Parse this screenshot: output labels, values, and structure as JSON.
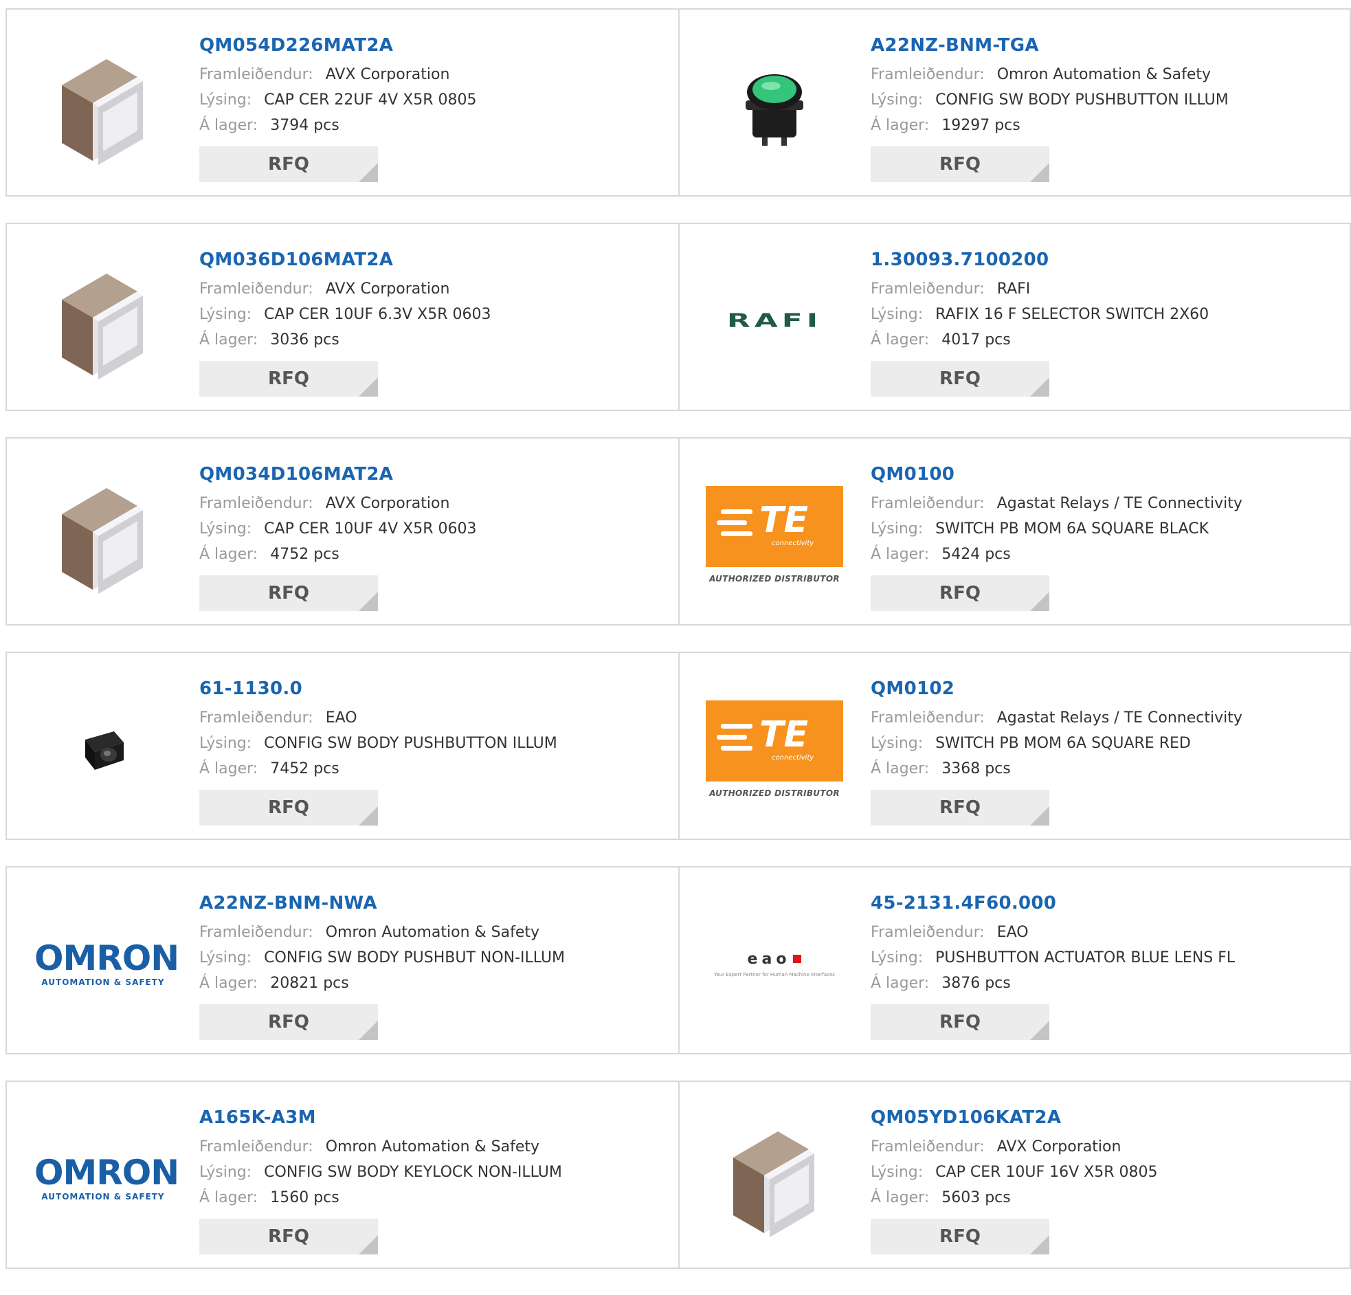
{
  "labels": {
    "manufacturer": "Framleiðendur:",
    "description": "Lýsing:",
    "stock": "Á lager:",
    "rfq": "RFQ"
  },
  "products": [
    {
      "part": "QM054D226MAT2A",
      "manufacturer": "AVX Corporation",
      "description": "CAP CER 22UF 4V X5R 0805",
      "stock": "3794 pcs",
      "image": "capacitor-chip"
    },
    {
      "part": "A22NZ-BNM-TGA",
      "manufacturer": "Omron Automation & Safety",
      "description": "CONFIG SW BODY PUSHBUTTON ILLUM",
      "stock": "19297 pcs",
      "image": "green-pushbutton"
    },
    {
      "part": "QM036D106MAT2A",
      "manufacturer": "AVX Corporation",
      "description": "CAP CER 10UF 6.3V X5R 0603",
      "stock": "3036 pcs",
      "image": "capacitor-chip"
    },
    {
      "part": "1.30093.7100200",
      "manufacturer": "RAFI",
      "description": "RAFIX 16 F SELECTOR SWITCH 2X60",
      "stock": "4017 pcs",
      "image": "rafi-logo",
      "logo_text": "RAFI"
    },
    {
      "part": "QM034D106MAT2A",
      "manufacturer": "AVX Corporation",
      "description": "CAP CER 10UF 4V X5R 0603",
      "stock": "4752 pcs",
      "image": "capacitor-chip"
    },
    {
      "part": "QM0100",
      "manufacturer": "Agastat Relays / TE Connectivity",
      "description": "SWITCH PB MOM 6A SQUARE BLACK",
      "stock": "5424 pcs",
      "image": "te-logo",
      "logo_text": "TE",
      "logo_sub": "connectivity",
      "logo_caption": "AUTHORIZED DISTRIBUTOR"
    },
    {
      "part": "61-1130.0",
      "manufacturer": "EAO",
      "description": "CONFIG SW BODY PUSHBUTTON ILLUM",
      "stock": "7452 pcs",
      "image": "black-pushbutton"
    },
    {
      "part": "QM0102",
      "manufacturer": "Agastat Relays / TE Connectivity",
      "description": "SWITCH PB MOM 6A SQUARE RED",
      "stock": "3368 pcs",
      "image": "te-logo",
      "logo_text": "TE",
      "logo_sub": "connectivity",
      "logo_caption": "AUTHORIZED DISTRIBUTOR"
    },
    {
      "part": "A22NZ-BNM-NWA",
      "manufacturer": "Omron Automation & Safety",
      "description": "CONFIG SW BODY PUSHBUT NON-ILLUM",
      "stock": "20821 pcs",
      "image": "omron-logo",
      "logo_text": "OMRON",
      "logo_sub": "AUTOMATION & SAFETY"
    },
    {
      "part": "45-2131.4F60.000",
      "manufacturer": "EAO",
      "description": "PUSHBUTTON ACTUATOR BLUE LENS FL",
      "stock": "3876 pcs",
      "image": "eao-logo",
      "logo_text": "eao",
      "logo_sub": "Your Expert Partner for Human Machine Interfaces"
    },
    {
      "part": "A165K-A3M",
      "manufacturer": "Omron Automation & Safety",
      "description": "CONFIG SW BODY KEYLOCK NON-ILLUM",
      "stock": "1560 pcs",
      "image": "omron-logo",
      "logo_text": "OMRON",
      "logo_sub": "AUTOMATION & SAFETY"
    },
    {
      "part": "QM05YD106KAT2A",
      "manufacturer": "AVX Corporation",
      "description": "CAP CER 10UF 16V X5R 0805",
      "stock": "5603 pcs",
      "image": "capacitor-chip"
    }
  ]
}
